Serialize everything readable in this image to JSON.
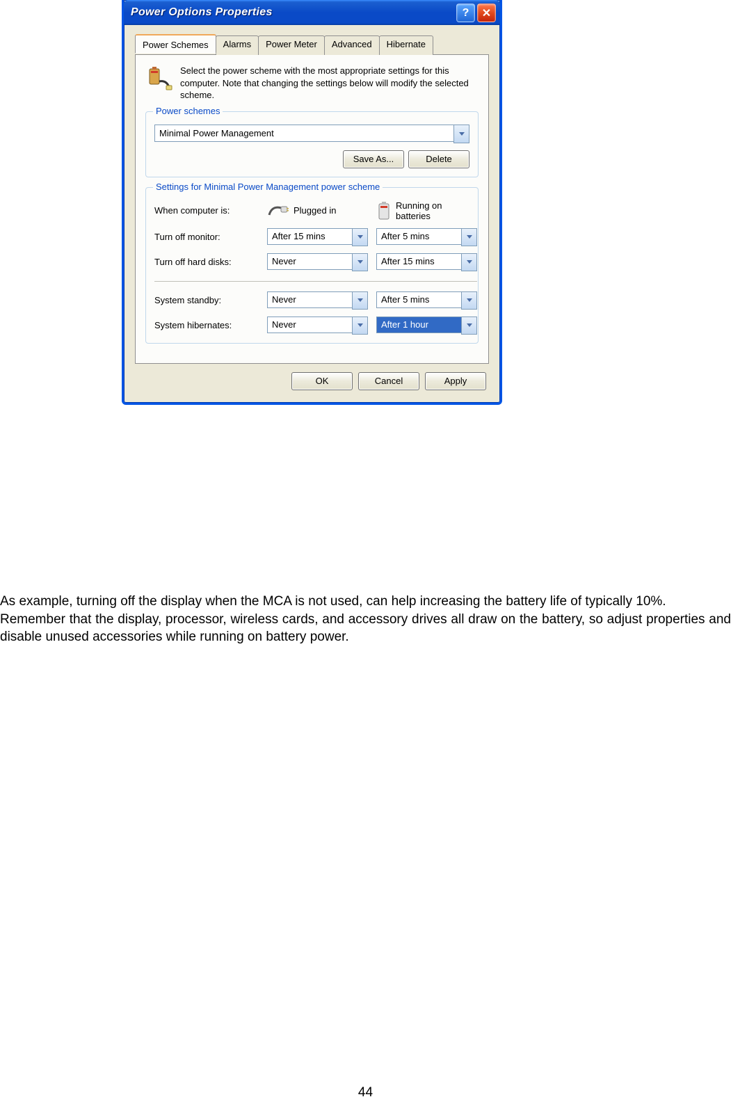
{
  "dialog": {
    "title": "Power Options Properties",
    "intro": "Select the power scheme with the most appropriate settings for this computer. Note that changing the settings below will modify the selected scheme.",
    "tabs": [
      "Power Schemes",
      "Alarms",
      "Power Meter",
      "Advanced",
      "Hibernate"
    ],
    "groupbox1_title": "Power schemes",
    "groupbox2_title": "Settings for Minimal Power Management power scheme",
    "scheme_value": "Minimal Power Management",
    "btn_saveas": "Save As...",
    "btn_delete": "Delete",
    "col_when": "When computer is:",
    "col_plugged": "Plugged in",
    "col_battery": "Running on batteries",
    "rows": {
      "monitor_label": "Turn off monitor:",
      "monitor_plugged": "After 15 mins",
      "monitor_battery": "After 5 mins",
      "hdd_label": "Turn off hard disks:",
      "hdd_plugged": "Never",
      "hdd_battery": "After 15 mins",
      "standby_label": "System standby:",
      "standby_plugged": "Never",
      "standby_battery": "After 5 mins",
      "hibernate_label": "System hibernates:",
      "hibernate_plugged": "Never",
      "hibernate_battery": "After 1 hour"
    },
    "btn_ok": "OK",
    "btn_cancel": "Cancel",
    "btn_apply": "Apply"
  },
  "body": {
    "p1": "As example, turning off the display when the MCA is not used, can help increasing the battery life of typically 10%.",
    "p2": "Remember that the display, processor, wireless cards, and accessory drives all draw on the battery, so adjust properties and disable unused accessories while running on battery power."
  },
  "pagenum": "44"
}
